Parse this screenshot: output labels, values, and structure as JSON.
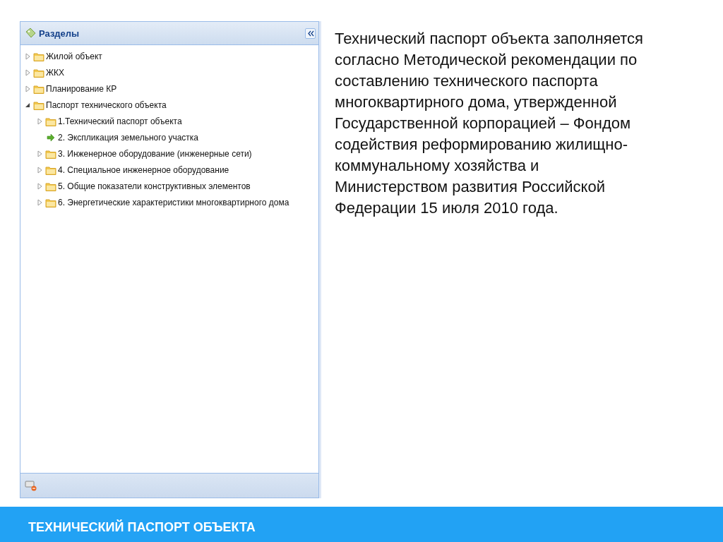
{
  "panel": {
    "title": "Разделы",
    "tree": [
      {
        "label": "Жилой объект",
        "kind": "folder",
        "expanded": false
      },
      {
        "label": "ЖКХ",
        "kind": "folder",
        "expanded": false
      },
      {
        "label": "Планирование КР",
        "kind": "folder",
        "expanded": false
      },
      {
        "label": "Паспорт технического объекта",
        "kind": "folder",
        "expanded": true,
        "children": [
          {
            "label": "1.Технический паспорт объекта",
            "kind": "folder",
            "expanded": false
          },
          {
            "label": "2. Экспликация земельного участка",
            "kind": "leaf"
          },
          {
            "label": "3. Инженерное оборудование (инженерные сети)",
            "kind": "folder",
            "expanded": false
          },
          {
            "label": "4. Специальное инженерное оборудование",
            "kind": "folder",
            "expanded": false
          },
          {
            "label": "5. Общие показатели конструктивных элементов",
            "kind": "folder",
            "expanded": false
          },
          {
            "label": "6. Энергетические характеристики многоквартирного дома",
            "kind": "folder",
            "expanded": false
          }
        ]
      }
    ]
  },
  "description": "Технический паспорт объекта заполняется согласно Методической рекомендации по составлению технического паспорта многоквартирного дома, утвержденной Государственной корпорацией – Фондом содействия реформированию жилищно-коммунальному хозяйства и Министерством развития Российской Федерации 15 июля 2010 года.",
  "footer": {
    "title": "ТЕХНИЧЕСКИЙ ПАСПОРТ ОБЪЕКТА"
  }
}
